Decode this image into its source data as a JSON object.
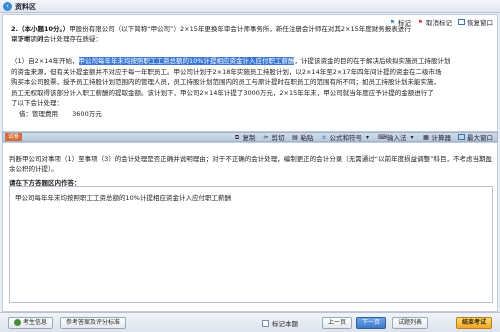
{
  "app": {
    "title": "资料区"
  },
  "toolbar": {
    "mark": "标记",
    "unmark": "取消标记",
    "restore": "恢复窗口"
  },
  "question": {
    "number": "2.",
    "score": "（本小题10分。）",
    "intro_1": "甲股份有限公司（以下简称“甲公司”）2×15年更换年审会计师事务所，新任注册会计师在对其2×15年度财务报表进行审计时，对",
    "intro_2": "以下事项的会计处理存在质疑：",
    "p1_prefix": "（1）自2×14年开始，",
    "p1_highlight": "甲公司每年年末均按照职工工资总额的10%计提相应资金计入应付职工薪酬",
    "p1_rest": "，计提该资金的目的在于解决后续拟实施员工持股计划",
    "p2": "的资金来源，但有关计提金额并不对应于每一年职员工。甲公司计划于2×18年实施员工持股计划，以2×14年至2×17年四年间计提的资金在二级市场",
    "p3": "购买本公司股票，授予员工持股计划范围内的管理人员，员工持股计划范围内的员工与原计提时在职员工的范围有所不同；如员工持股计划未能实施，",
    "p4": "员工无权取得该部分计入职工薪酬的提取金额。该计划下，甲公司2×14年计提了3000万元，2×15年年末，甲公司就当年度应予计提的金额进行了",
    "p5": "了以下会计处理：",
    "entry_label": "借：管理费用",
    "entry_amount": "3600万元"
  },
  "split": {
    "label": "试卷"
  },
  "answer_toolbar": {
    "copy": "复制",
    "cut": "剪切",
    "paste": "粘贴",
    "formula": "公式和符号",
    "input": "输入法",
    "calculator": "计算器",
    "maximize": "最大窗口"
  },
  "instruction": "判断甲公司对事项（1）至事项（3）的会计处理是否正确并说明理由；对于不正确的会计处理，编制更正的会计分录（无需通过“以前年度损益调整”科目，不考虑当期盈余公积的计提）。",
  "answer_prompt": "请在下方答题区内作答：",
  "answer_text": "甲公司每年年末均按照职工工资总额的10%计提相应资金计入应付职工薪酬",
  "bottom": {
    "candidate": "考生信息",
    "reference": "参考答案及评分标准",
    "mark_question": "标记本题",
    "prev": "上一页",
    "next": "下一页",
    "list": "试题列表",
    "finish": "结束考试"
  }
}
